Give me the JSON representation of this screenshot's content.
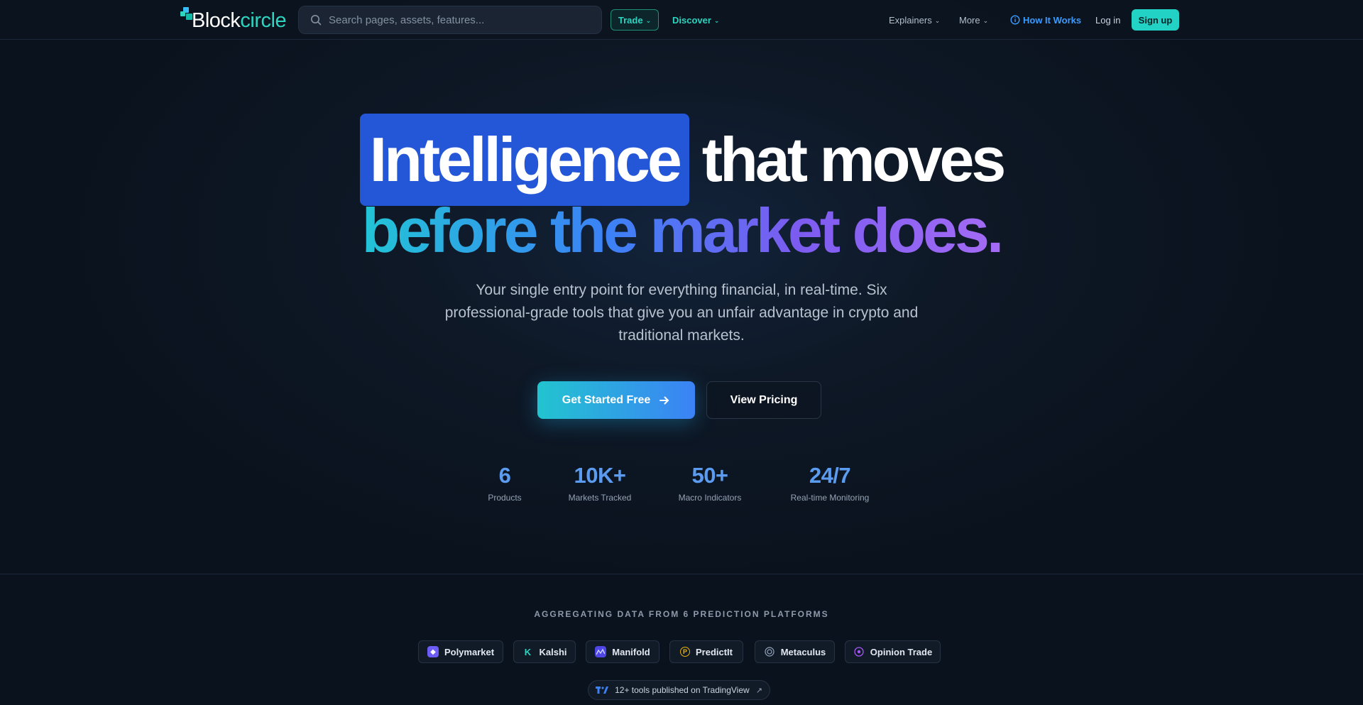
{
  "nav": {
    "logo": {
      "part1": "Block",
      "part2": "circle"
    },
    "search_placeholder": "Search pages, assets, features...",
    "trade": "Trade",
    "discover": "Discover",
    "explainers": "Explainers",
    "more": "More",
    "how_it_works": "How It Works",
    "login": "Log in",
    "signup": "Sign up"
  },
  "hero": {
    "highlight": "Intelligence",
    "line1_rest": "that moves",
    "line2": "before the market does.",
    "subtitle": "Your single entry point for everything financial, in real-time. Six professional-grade tools that give you an unfair advantage in crypto and traditional markets.",
    "cta_primary": "Get Started Free",
    "cta_secondary": "View Pricing"
  },
  "stats": [
    {
      "value": "6",
      "label": "Products"
    },
    {
      "value": "10K+",
      "label": "Markets Tracked"
    },
    {
      "value": "50+",
      "label": "Macro Indicators"
    },
    {
      "value": "24/7",
      "label": "Real-time Monitoring"
    }
  ],
  "aggregation": {
    "title": "AGGREGATING DATA FROM 6 PREDICTION PLATFORMS",
    "platforms": [
      {
        "name": "Polymarket",
        "icon": "polymarket-icon",
        "color": "#6d5cf5"
      },
      {
        "name": "Kalshi",
        "icon": "kalshi-icon",
        "color": "#2dd4bf"
      },
      {
        "name": "Manifold",
        "icon": "manifold-icon",
        "color": "#4f46e5"
      },
      {
        "name": "PredictIt",
        "icon": "predictit-icon",
        "color": "#eab308"
      },
      {
        "name": "Metaculus",
        "icon": "metaculus-icon",
        "color": "#93a4bb"
      },
      {
        "name": "Opinion Trade",
        "icon": "opinion-trade-icon",
        "color": "#a855f7"
      }
    ],
    "tradingview": "12+ tools published on TradingView"
  },
  "colors": {
    "accent_teal": "#2dd4bf",
    "accent_blue": "#3b82f6",
    "highlight_bg": "#2456d8",
    "background": "#0e1826"
  }
}
